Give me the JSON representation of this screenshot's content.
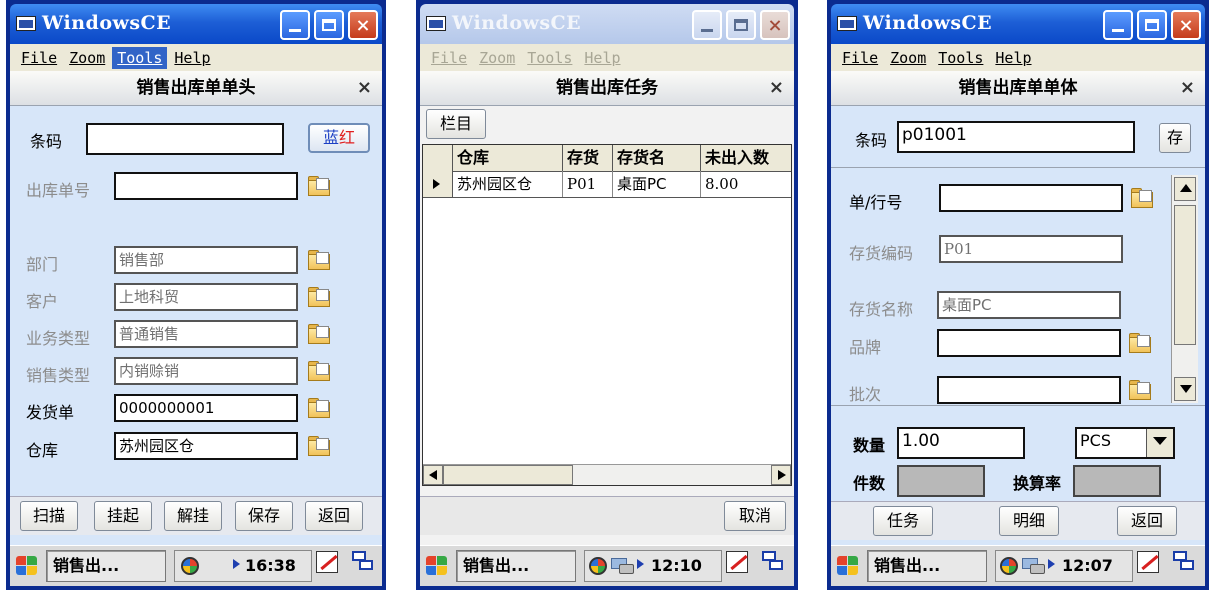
{
  "window_title": "WindowsCE",
  "menus": [
    "File",
    "Zoom",
    "Tools",
    "Help"
  ],
  "close_glyph": "×",
  "screen1": {
    "form_title": "销售出库单单头",
    "barcode_label": "条码",
    "barcode_value": "",
    "color_button": {
      "blue": "蓝",
      "red": "红",
      "blue_color": "#1c3fc4",
      "red_color": "#e02020"
    },
    "fields": [
      {
        "label": "出库单号",
        "value": "",
        "enabled": false
      },
      {
        "label": "部门",
        "value": "销售部",
        "enabled": false
      },
      {
        "label": "客户",
        "value": "上地科贸",
        "enabled": false
      },
      {
        "label": "业务类型",
        "value": "普通销售",
        "enabled": false
      },
      {
        "label": "销售类型",
        "value": "内销赊销",
        "enabled": false
      },
      {
        "label": "发货单",
        "value": "0000000001",
        "enabled": true
      },
      {
        "label": "仓库",
        "value": "苏州园区仓",
        "enabled": true
      }
    ],
    "buttons": [
      "扫描",
      "挂起",
      "解挂",
      "保存",
      "返回"
    ],
    "taskbar": {
      "app": "销售出...",
      "time": "16:38"
    }
  },
  "screen2": {
    "form_title": "销售出库任务",
    "column_button": "栏目",
    "table": {
      "headers": [
        "仓库",
        "存货",
        "存货名",
        "未出入数"
      ],
      "rows": [
        [
          "苏州园区仓",
          "P01",
          "桌面PC",
          "8.00"
        ]
      ]
    },
    "cancel_button": "取消",
    "taskbar": {
      "app": "销售出...",
      "time": "12:10"
    }
  },
  "screen3": {
    "form_title": "销售出库单单体",
    "barcode_label": "条码",
    "barcode_value": "p01001",
    "save_button": "存",
    "fields": [
      {
        "label": "单/行号",
        "value": "",
        "enabled": true
      },
      {
        "label": "存货编码",
        "value": "P01",
        "enabled": false
      },
      {
        "label": "存货名称",
        "value": "桌面PC",
        "enabled": false
      },
      {
        "label": "品牌",
        "value": "",
        "enabled": false
      },
      {
        "label": "批次",
        "value": "",
        "enabled": false
      }
    ],
    "qty_label": "数量",
    "qty_value": "1.00",
    "unit_value": "PCS",
    "pieces_label": "件数",
    "rate_label": "换算率",
    "buttons": [
      "任务",
      "明细",
      "返回"
    ],
    "taskbar": {
      "app": "销售出...",
      "time": "12:07"
    }
  }
}
